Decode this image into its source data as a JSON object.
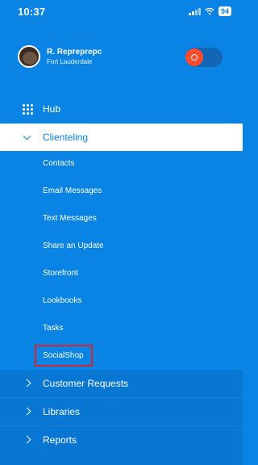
{
  "status": {
    "time": "10:37",
    "battery": "94"
  },
  "profile": {
    "name": "R. Repreprepc",
    "location": "Fort Lauderdale"
  },
  "menu": {
    "hub": "Hub",
    "clienteling": "Clienteling",
    "sub_items": [
      "Contacts",
      "Email Messages",
      "Text Messages",
      "Share an Update",
      "Storefront",
      "Lookbooks",
      "Tasks",
      "SocialShop"
    ],
    "lower_items": [
      "Customer Requests",
      "Libraries",
      "Reports"
    ]
  },
  "colors": {
    "accent": "#0a84e4",
    "highlight": "#d7252d",
    "toggle_knob": "#ff4b2b"
  }
}
